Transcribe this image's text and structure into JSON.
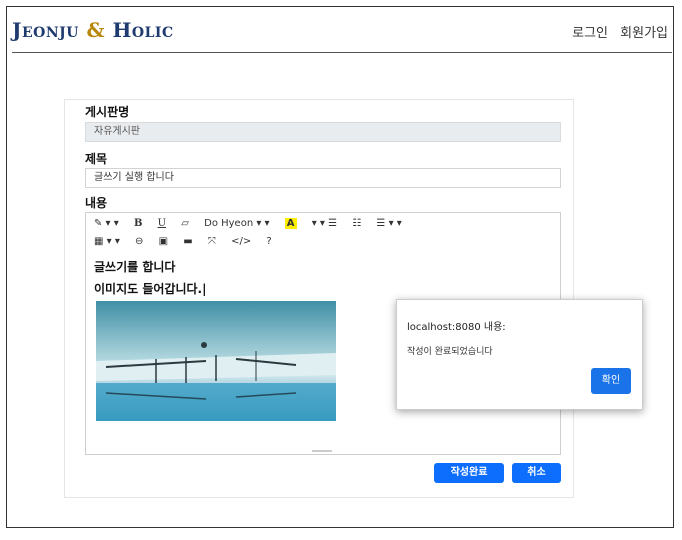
{
  "header": {
    "brand_j": "J",
    "brand_eonju": "EONJU",
    "brand_amp": "&",
    "brand_h": "H",
    "brand_olic": "OLIC",
    "nav": [
      "로그인",
      "회원가입"
    ]
  },
  "form": {
    "board_label": "게시판명",
    "board_value": "자유게시판",
    "title_label": "제목",
    "title_value": "글쓰기 실행 합니다",
    "content_label": "내용"
  },
  "editor": {
    "toolbar_row1": [
      "✎ ▾ ▾",
      "B",
      "U",
      "▱",
      "Do Hyeon ▾ ▾",
      "A",
      "▾ ▾ ☰",
      "☷",
      "☰ ▾ ▾"
    ],
    "toolbar_row2": [
      "▦ ▾ ▾",
      "⊖",
      "▣",
      "▬",
      "⤧",
      "</>",
      "?"
    ],
    "lines": [
      "글쓰기를 합니다",
      "이미지도 들어갑니다.|"
    ],
    "font_name": "Do Hyeon"
  },
  "buttons": {
    "submit": "작성완료",
    "cancel": "취소"
  },
  "dialog": {
    "title": "localhost:8080 내용:",
    "message": "작성이 완료되었습니다",
    "ok": "확인"
  },
  "colors": {
    "primary": "#0d6efd",
    "brand": "#1f3a6e",
    "dialog_ok": "#1a73e8"
  }
}
